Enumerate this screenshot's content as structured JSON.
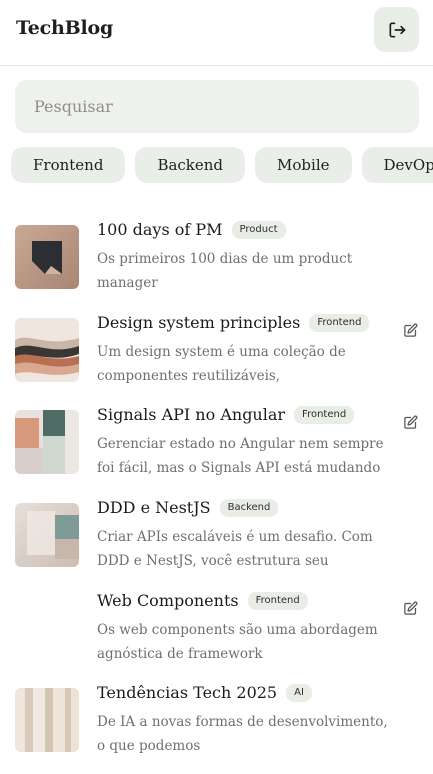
{
  "header": {
    "brand": "TechBlog",
    "logout_icon": "logout-icon"
  },
  "search": {
    "placeholder": "Pesquisar",
    "value": ""
  },
  "categories": [
    "Frontend",
    "Backend",
    "Mobile",
    "DevOps"
  ],
  "posts": [
    {
      "title": "100 days of PM",
      "tag": "Product",
      "description": "Os primeiros 100 dias de um product manager",
      "editable": false,
      "thumbnail": "bookmark-graphic"
    },
    {
      "title": "Design system principles",
      "tag": "Frontend",
      "description": "Um design system é uma coleção de componentes reutilizáveis,",
      "editable": true,
      "thumbnail": "wave-layers"
    },
    {
      "title": "Signals API no Angular",
      "tag": "Frontend",
      "description": "Gerenciar estado no Angular nem sempre foi fácil, mas o Signals API está mudando",
      "editable": true,
      "thumbnail": "abstract-blocks"
    },
    {
      "title": "DDD e NestJS",
      "tag": "Backend",
      "description": "Criar APIs escaláveis é um desafio. Com DDD e NestJS, você estrutura seu",
      "editable": false,
      "thumbnail": "frosted-glass"
    },
    {
      "title": "Web Components",
      "tag": "Frontend",
      "description": "Os web components são uma abordagem agnóstica de framework",
      "editable": true,
      "thumbnail": "none"
    },
    {
      "title": "Tendências Tech 2025",
      "tag": "AI",
      "description": "De IA a novas formas de desenvolvimento, o que podemos",
      "editable": false,
      "thumbnail": "ribbed-panels"
    }
  ],
  "colors": {
    "surface": "#eef1ec",
    "chip": "#eaeee8",
    "badge": "#e8ede6",
    "title": "#1b1b1b",
    "muted": "#6f6f6f"
  }
}
